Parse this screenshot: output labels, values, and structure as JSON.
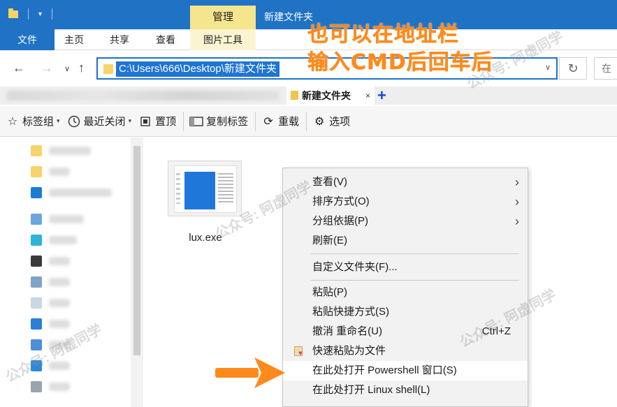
{
  "ribbon": {
    "contextual_tab": "管理",
    "window_title": "新建文件夹",
    "tabs": [
      "文件",
      "主页",
      "共享",
      "查看",
      "图片工具"
    ]
  },
  "address": {
    "path": "C:\\Users\\666\\Desktop\\新建文件夹",
    "search_placeholder": "在"
  },
  "annotation": {
    "line1": "也可以在地址栏",
    "line2": "输入CMD后回车后",
    "color": "#ff8a1c"
  },
  "doc_tabs": {
    "active": "新建文件夹",
    "close_glyph": "×",
    "add_glyph": "+"
  },
  "toolbar": {
    "bookmarks": "标签组",
    "recent_closed": "最近关闭",
    "pin": "置顶",
    "copy_tab": "复制标签",
    "reload": "重载",
    "options": "选项"
  },
  "file": {
    "name": "lux.exe"
  },
  "context_menu": {
    "view": "查看(V)",
    "sort": "排序方式(O)",
    "group": "分组依据(P)",
    "refresh": "刷新(E)",
    "customize": "自定义文件夹(F)...",
    "paste": "粘贴(P)",
    "paste_shortcut": "粘贴快捷方式(S)",
    "undo_rename": "撤消 重命名(U)",
    "undo_shortcut": "Ctrl+Z",
    "quick_paste": "快速粘贴为文件",
    "open_powershell": "在此处打开 Powershell 窗口(S)",
    "open_linux": "在此处打开 Linux shell(L)"
  },
  "watermark": "公众号: 阿虚同学",
  "colors": {
    "ribbon_blue": "#1f72c4",
    "contextual_yellow": "#f6e58f",
    "address_highlight": "#1f74d4",
    "arrow_orange": "#ff8a1c"
  }
}
